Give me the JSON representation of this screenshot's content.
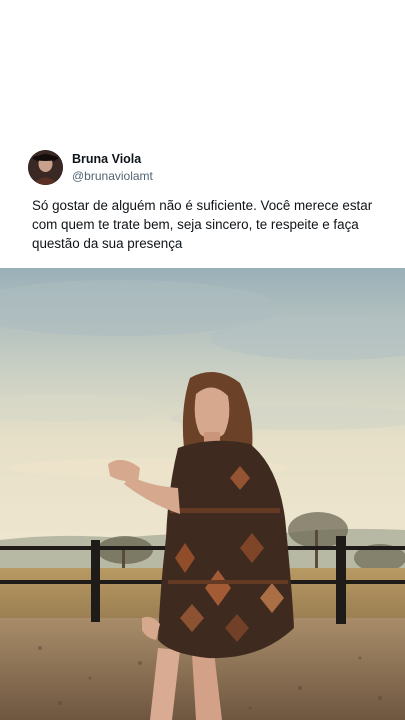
{
  "post": {
    "author_name": "Bruna Viola",
    "author_handle": "@brunaviolamt",
    "text": "Só gostar de alguém não é suficiente. Você merece estar com quem te trate bem, seja sincero, te respeite e faça questão da sua presença"
  },
  "icons": {
    "avatar": "profile-photo"
  },
  "colors": {
    "name": "#0f1419",
    "handle": "#536471",
    "background": "#ffffff"
  }
}
